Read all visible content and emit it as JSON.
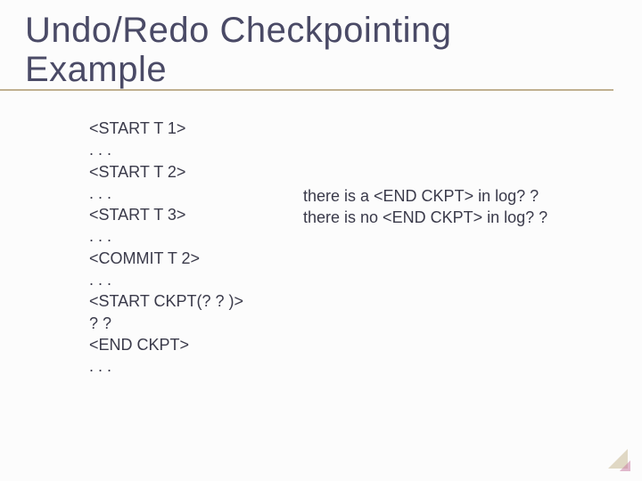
{
  "title_line1": "Undo/Redo Checkpointing",
  "title_line2": "Example",
  "log": {
    "l0": "<START T 1>",
    "l1": ". . .",
    "l2": "<START T 2>",
    "l3": ". . .",
    "l4": "<START T 3>",
    "l5": ". . .",
    "l6": "<COMMIT T 2>",
    "l7": ". . .",
    "l8": "<START CKPT(? ? )>",
    "l9": "? ?",
    "l10": "<END CKPT>",
    "l11": ". . ."
  },
  "right": {
    "q1": "there is a <END CKPT> in log? ?",
    "q2": "there is no <END CKPT> in log? ?"
  }
}
